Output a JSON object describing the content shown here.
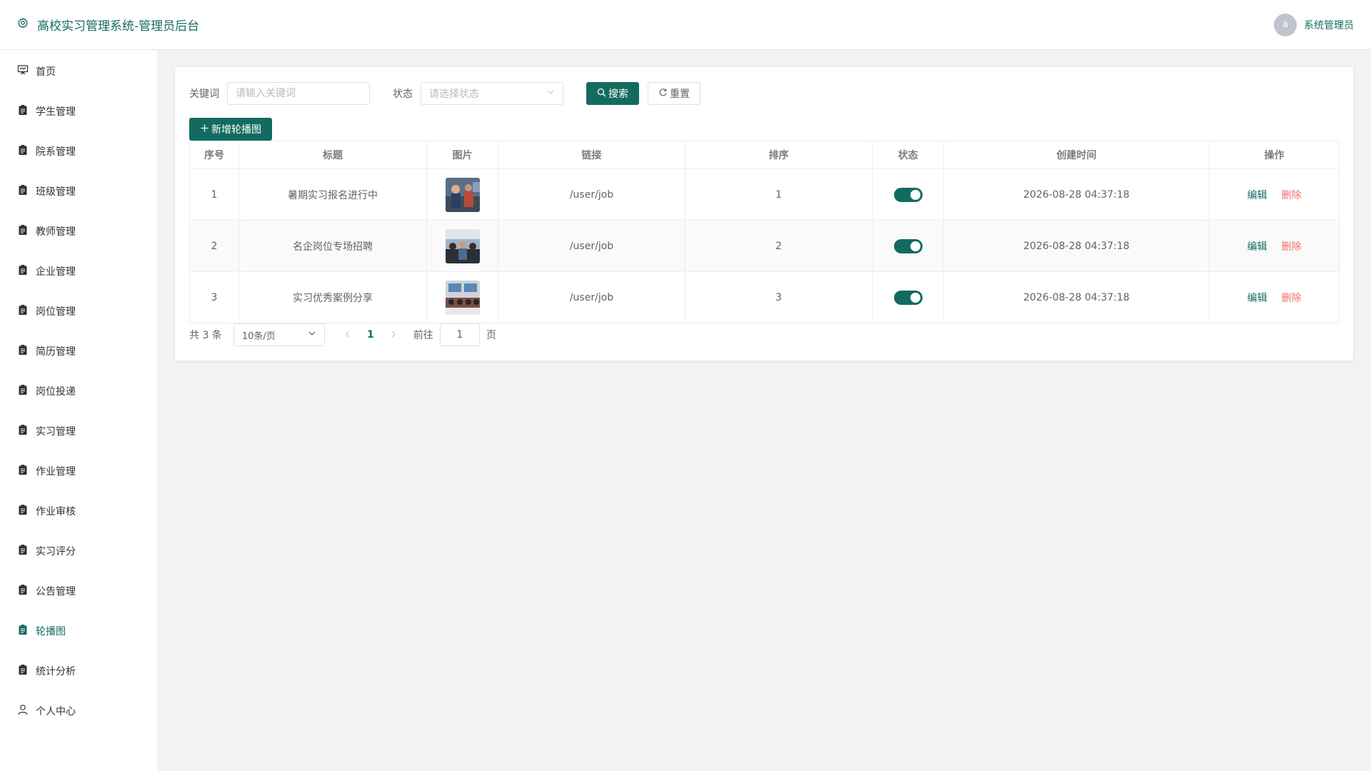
{
  "header": {
    "title": "高校实习管理系统-管理员后台",
    "avatar_letter": "a",
    "username": "系统管理员"
  },
  "sidebar": {
    "items": [
      {
        "label": "首页",
        "icon": "presentation-icon"
      },
      {
        "label": "学生管理",
        "icon": "clipboard-icon"
      },
      {
        "label": "院系管理",
        "icon": "clipboard-icon"
      },
      {
        "label": "班级管理",
        "icon": "clipboard-icon"
      },
      {
        "label": "教师管理",
        "icon": "clipboard-icon"
      },
      {
        "label": "企业管理",
        "icon": "clipboard-icon"
      },
      {
        "label": "岗位管理",
        "icon": "clipboard-icon"
      },
      {
        "label": "简历管理",
        "icon": "clipboard-icon"
      },
      {
        "label": "岗位投递",
        "icon": "clipboard-icon"
      },
      {
        "label": "实习管理",
        "icon": "clipboard-icon"
      },
      {
        "label": "作业管理",
        "icon": "clipboard-icon"
      },
      {
        "label": "作业审核",
        "icon": "clipboard-icon"
      },
      {
        "label": "实习评分",
        "icon": "clipboard-icon"
      },
      {
        "label": "公告管理",
        "icon": "clipboard-icon"
      },
      {
        "label": "轮播图",
        "icon": "clipboard-icon",
        "active": true
      },
      {
        "label": "统计分析",
        "icon": "clipboard-icon"
      },
      {
        "label": "个人中心",
        "icon": "user-icon"
      }
    ]
  },
  "search": {
    "keyword_label": "关键词",
    "keyword_placeholder": "请输入关键词",
    "keyword_value": "",
    "status_label": "状态",
    "status_placeholder": "请选择状态",
    "search_button": "搜索",
    "reset_button": "重置"
  },
  "add_button": "新增轮播图",
  "table": {
    "headers": [
      "序号",
      "标题",
      "图片",
      "链接",
      "排序",
      "状态",
      "创建时间",
      "操作"
    ],
    "rows": [
      {
        "index": "1",
        "title": "暑期实习报名进行中",
        "link": "/user/job",
        "sort": "1",
        "status_on": true,
        "created": "2026-08-28 04:37:18"
      },
      {
        "index": "2",
        "title": "名企岗位专场招聘",
        "link": "/user/job",
        "sort": "2",
        "status_on": true,
        "created": "2026-08-28 04:37:18"
      },
      {
        "index": "3",
        "title": "实习优秀案例分享",
        "link": "/user/job",
        "sort": "3",
        "status_on": true,
        "created": "2026-08-28 04:37:18"
      }
    ],
    "edit_label": "编辑",
    "delete_label": "删除"
  },
  "pagination": {
    "total_text": "共 3 条",
    "page_size": "10条/页",
    "current_page": "1",
    "goto_label": "前往",
    "goto_value": "1",
    "page_suffix": "页"
  },
  "colors": {
    "primary": "#136b60",
    "danger": "#f56c6c",
    "background": "#f2f2f2"
  }
}
